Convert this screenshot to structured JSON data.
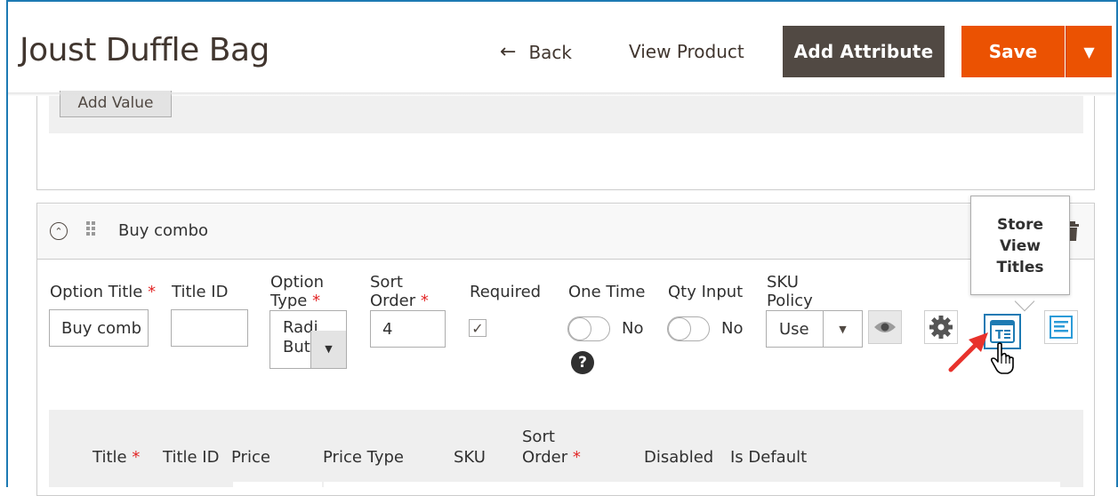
{
  "header": {
    "title": "Joust Duffle Bag",
    "back_label": "Back",
    "back_arrow": "←",
    "view_product_label": "View Product",
    "add_attribute_label": "Add Attribute",
    "save_label": "Save",
    "save_dropdown_arrow": "▼"
  },
  "upper_section": {
    "add_value_label": "Add Value"
  },
  "option": {
    "name": "Buy combo",
    "collapse_glyph": "⌃",
    "fields": {
      "option_title_label": "Option Title",
      "option_title_value": "Buy comb",
      "title_id_label": "Title ID",
      "title_id_value": "",
      "option_type_label_1": "Option",
      "option_type_label_2": "Type",
      "option_type_value_1": "Radio",
      "option_type_value_2": "Butt",
      "sort_order_label_1": "Sort",
      "sort_order_label_2": "Order",
      "sort_order_value": "4",
      "required_label": "Required",
      "required_check": "✓",
      "one_time_label": "One Time",
      "one_time_state": "No",
      "qty_input_label": "Qty Input",
      "qty_input_state": "No",
      "help_glyph": "?",
      "sku_policy_label_1": "SKU",
      "sku_policy_label_2": "Policy",
      "sku_policy_value": "Use",
      "required_star": "*",
      "select_arrow": "▼"
    },
    "tooltip": {
      "line1": "Store",
      "line2": "View",
      "line3": "Titles"
    }
  },
  "values_table": {
    "columns": {
      "title": "Title",
      "title_id": "Title ID",
      "price": "Price",
      "price_type": "Price Type",
      "sku": "SKU",
      "sort_order_1": "Sort",
      "sort_order_2": "Order",
      "disabled": "Disabled",
      "is_default": "Is Default"
    }
  },
  "colors": {
    "save_orange": "#eb5202",
    "add_attribute_dark": "#514943",
    "frame_blue": "#1d7ab3",
    "required_red": "#e22626",
    "annotation_red": "#e8322c"
  },
  "icons": [
    "back-arrow-icon",
    "dropdown-arrow-icon",
    "collapse-icon",
    "drag-handle-icon",
    "trash-icon",
    "help-icon",
    "eye-icon",
    "gear-icon",
    "store-view-titles-icon",
    "description-icon",
    "hand-cursor-icon",
    "annotation-arrow-icon"
  ]
}
